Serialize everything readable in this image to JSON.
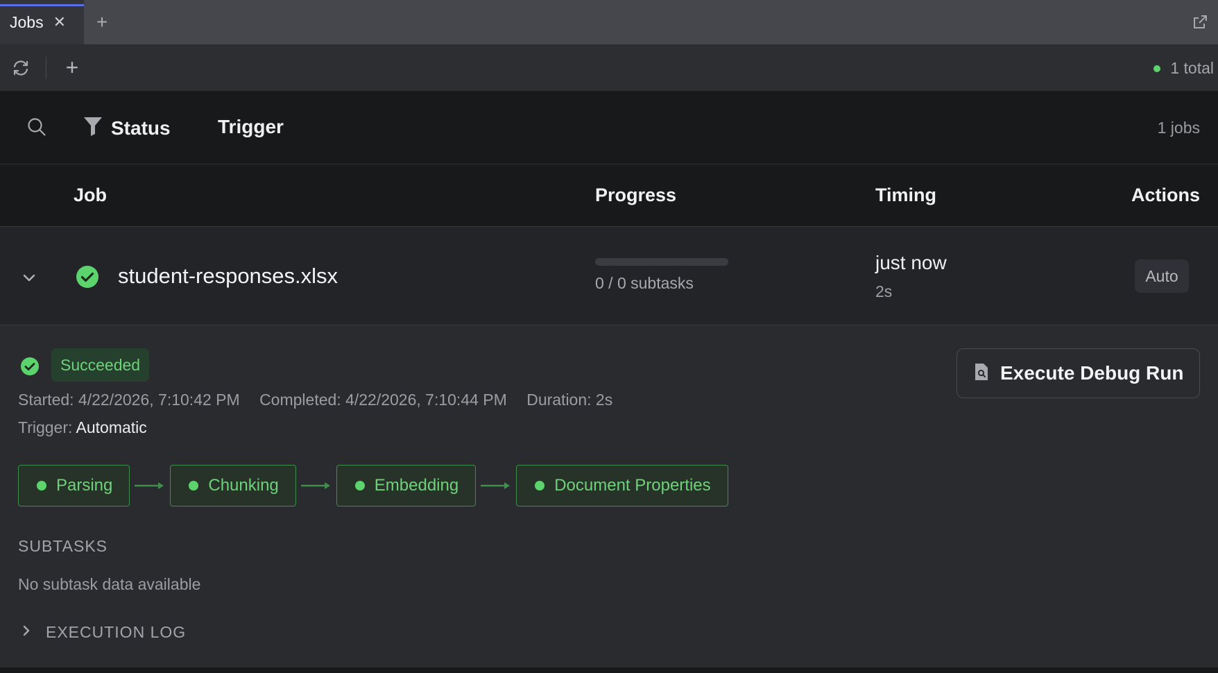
{
  "tab": {
    "label": "Jobs",
    "close": "✕",
    "add": "+"
  },
  "toolbar": {
    "add": "+",
    "total_text": "1 total",
    "total_dot_color": "#5cd36c"
  },
  "filters": {
    "status_label": "Status",
    "trigger_label": "Trigger",
    "jobs_count": "1 jobs"
  },
  "table": {
    "headers": {
      "job": "Job",
      "progress": "Progress",
      "timing": "Timing",
      "actions": "Actions"
    },
    "row": {
      "name": "student-responses.xlsx",
      "progress_fraction": 0,
      "progress_text": "0 / 0 subtasks",
      "timing_main": "just now",
      "timing_sub": "2s",
      "action_badge": "Auto"
    }
  },
  "detail": {
    "status": "Succeeded",
    "started": "Started: 4/22/2026, 7:10:42 PM",
    "completed": "Completed: 4/22/2026, 7:10:44 PM",
    "duration": "Duration: 2s",
    "trigger_label": "Trigger:",
    "trigger_value": "Automatic",
    "debug_button": "Execute Debug Run",
    "stages": [
      "Parsing",
      "Chunking",
      "Embedding",
      "Document Properties"
    ],
    "subtasks_title": "SUBTASKS",
    "no_subtasks": "No subtask data available",
    "execution_log": "EXECUTION LOG"
  },
  "colors": {
    "accent": "#5a6ee8",
    "success": "#5cd36c",
    "success_text": "#6ed27a"
  },
  "icons": {
    "tab_popout": "external-link-icon",
    "refresh": "refresh-icon",
    "search": "search-icon",
    "filter": "filter-icon",
    "row_expand": "chevron-down-icon",
    "success": "check-circle-icon",
    "debug": "document-search-icon",
    "log_expand": "chevron-right-icon"
  }
}
